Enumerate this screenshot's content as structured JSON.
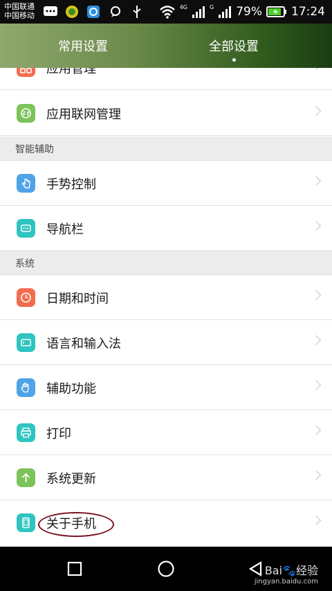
{
  "status_bar": {
    "carrier1": "中国联通",
    "carrier2": "中国移动",
    "network_tag_1": "4G",
    "network_tag_2": "G",
    "battery": "79%",
    "time": "17:24"
  },
  "tabs": [
    {
      "label": "常用设置",
      "active": false
    },
    {
      "label": "全部设置",
      "active": true
    }
  ],
  "rows": {
    "app_manage": "应用管理",
    "app_network": "应用联网管理",
    "gesture": "手势控制",
    "navbar": "导航栏",
    "datetime": "日期和时间",
    "language": "语言和输入法",
    "accessibility": "辅助功能",
    "print": "打印",
    "update": "系统更新",
    "about": "关于手机"
  },
  "sections": {
    "smart_assist": "智能辅助",
    "system": "系统"
  },
  "watermark": {
    "brand": "Bai",
    "brand_suffix": "经验",
    "url": "jingyan.baidu.com"
  },
  "colors": {
    "icon_orange": "#f26d4f",
    "icon_green": "#7cc35a",
    "icon_blue": "#4fa3e8",
    "icon_teal": "#2ec4c0",
    "annotation": "#7a1020"
  }
}
